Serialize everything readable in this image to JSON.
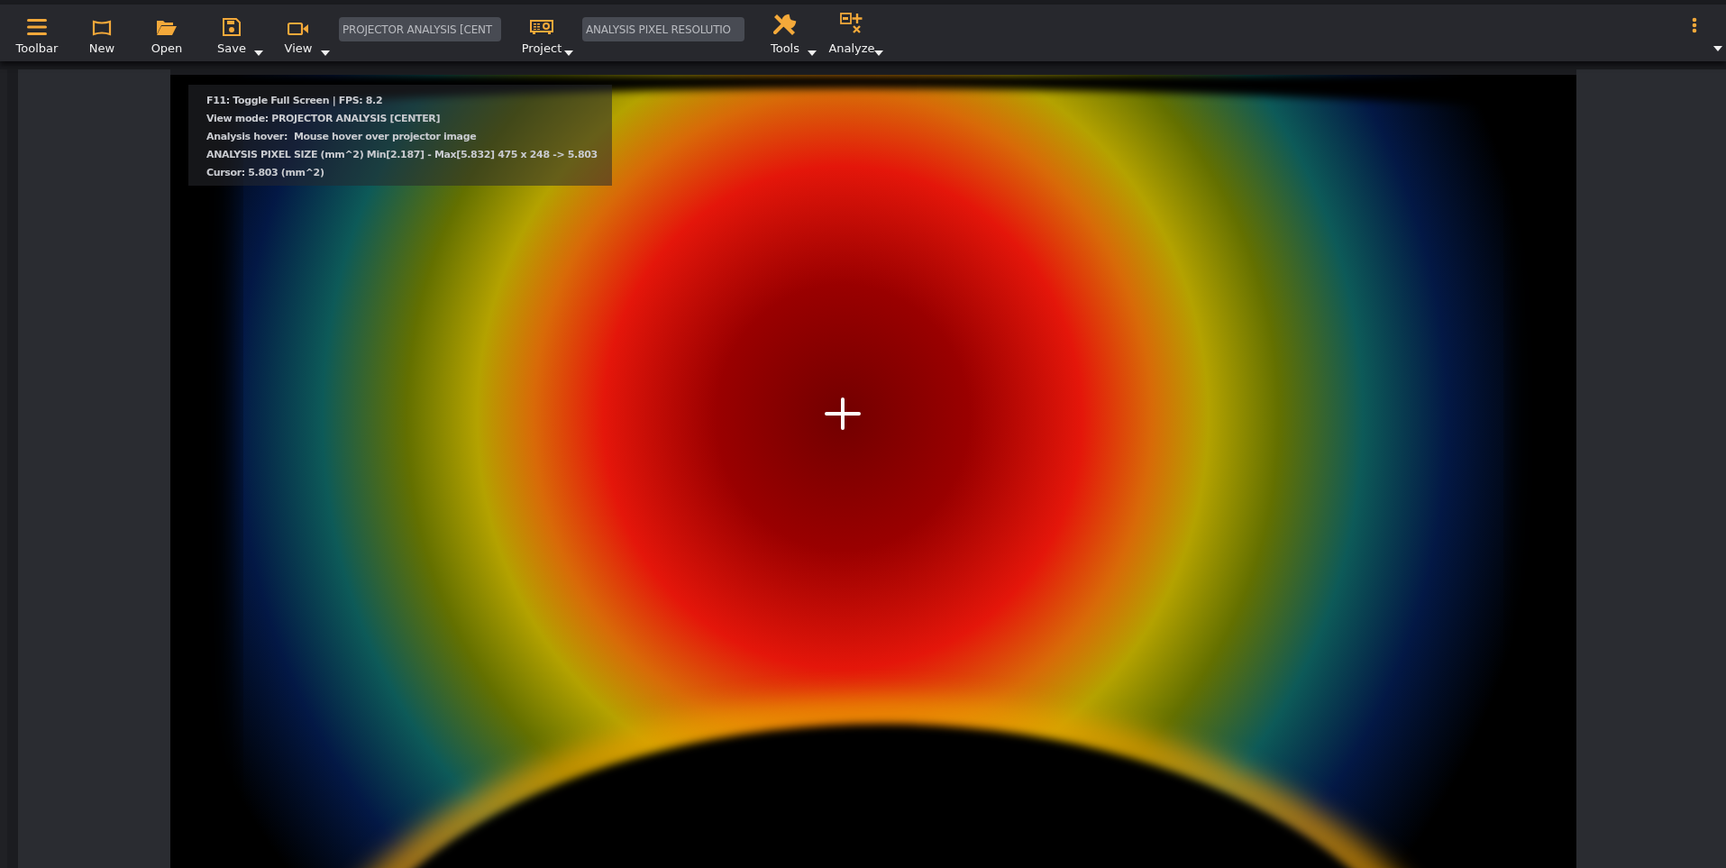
{
  "toolbar": {
    "items": [
      {
        "kind": "button",
        "label": "Toolbar",
        "dropdown": false
      },
      {
        "kind": "button",
        "label": "New",
        "dropdown": false
      },
      {
        "kind": "button",
        "label": "Open",
        "dropdown": false
      },
      {
        "kind": "button",
        "label": "Save",
        "dropdown": true
      },
      {
        "kind": "button",
        "label": "View",
        "dropdown": true
      },
      {
        "kind": "field",
        "value": "PROJECTOR ANALYSIS [CENT"
      },
      {
        "kind": "button",
        "label": "Project",
        "dropdown": true
      },
      {
        "kind": "field",
        "value": "ANALYSIS PIXEL RESOLUTIO"
      },
      {
        "kind": "button",
        "label": "Tools",
        "dropdown": true
      },
      {
        "kind": "button",
        "label": "Analyze",
        "dropdown": true
      }
    ]
  },
  "overlay": {
    "lines": [
      "F11: Toggle Full Screen | FPS: 8.2",
      "View mode: PROJECTOR ANALYSIS [CENTER]",
      "Analysis hover:  Mouse hover over projector image",
      "ANALYSIS PIXEL SIZE (mm^2) Min[2.187] - Max[5.832] 475 x 248 -> 5.803",
      "Cursor: 5.803 (mm^2)"
    ]
  }
}
